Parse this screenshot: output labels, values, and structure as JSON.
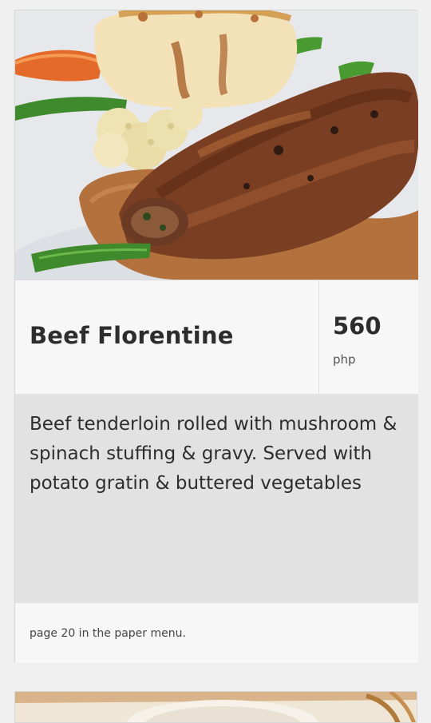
{
  "item": {
    "name": "Beef Florentine",
    "price": "560",
    "currency": "php",
    "description": "Beef tenderloin rolled with mushroom & spinach stuffing & gravy. Served with potato gratin & buttered vegetables",
    "menu_reference": "page 20 in the paper menu."
  },
  "images": {
    "dish_photo": "beef-florentine-photo",
    "next_dish_photo": "next-dish-photo-partial"
  }
}
